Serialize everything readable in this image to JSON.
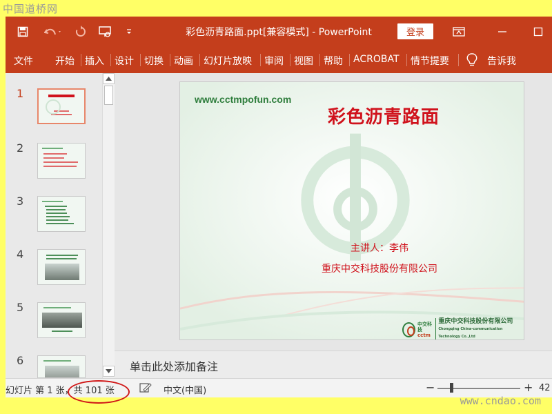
{
  "watermarks": {
    "top": "中国道桥网",
    "bottom": "www.cndao.com"
  },
  "titlebar": {
    "title": "彩色沥青路面.ppt[兼容模式]  -  PowerPoint",
    "login": "登录"
  },
  "ribbon": {
    "tabs": [
      "文件",
      "开始",
      "插入",
      "设计",
      "切换",
      "动画",
      "幻灯片放映",
      "审阅",
      "视图",
      "帮助",
      "ACROBAT",
      "情节提要"
    ],
    "tellme": "告诉我"
  },
  "thumbnails": {
    "numbers": [
      "1",
      "2",
      "3",
      "4",
      "5",
      "6"
    ],
    "active_index": 1
  },
  "slide": {
    "website": "www.cctmpofun.com",
    "title": "彩色沥青路面",
    "presenter": "主讲人：李伟",
    "company": "重庆中交科技股份有限公司",
    "footer_logo_top": "中交科技",
    "footer_logo_bottom": "cctm",
    "footer_company": "重庆中交科技股份有限公司",
    "footer_company_en": "Chongqing China-communication Technology Co.,Ltd"
  },
  "notes": {
    "placeholder": "单击此处添加备注"
  },
  "statusbar": {
    "slide_info": "幻灯片 第 1 张，共 101 张",
    "language": "中文(中国)",
    "zoom": "42",
    "zoom_out": "−",
    "zoom_in": "+"
  },
  "colors": {
    "accent": "#c43e1c",
    "slide_title": "#d0121c",
    "slide_green": "#2e7d3c"
  }
}
